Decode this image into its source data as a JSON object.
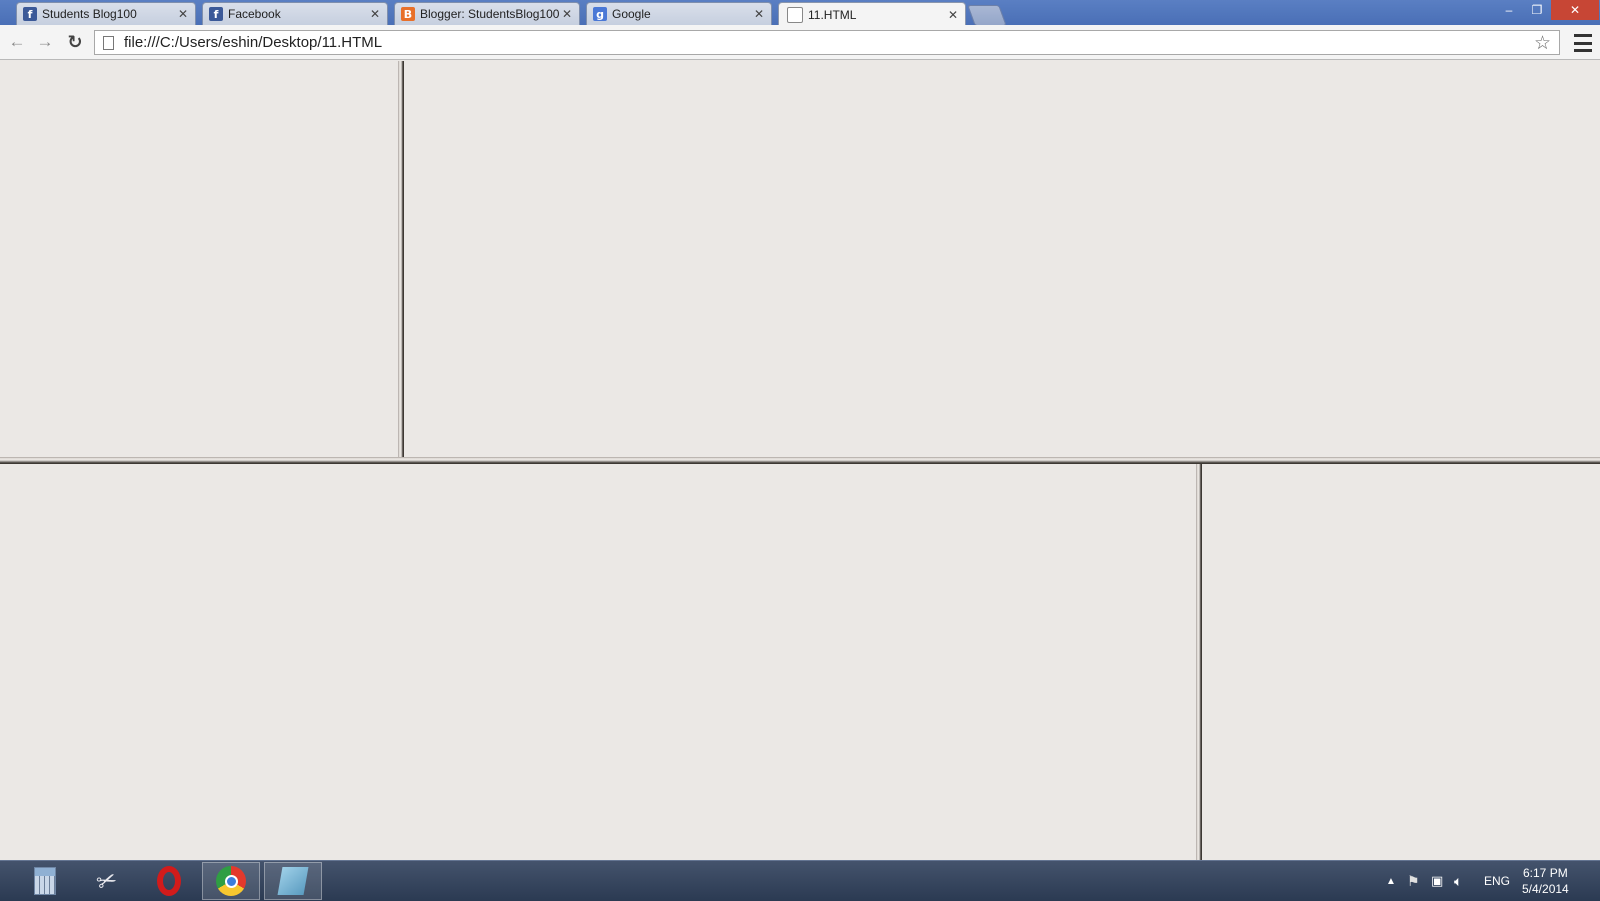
{
  "browser": {
    "tabs": [
      {
        "label": "Students Blog100",
        "icon": "facebook-icon",
        "active": false
      },
      {
        "label": "Facebook",
        "icon": "facebook-icon",
        "active": false
      },
      {
        "label": "Blogger: StudentsBlog100",
        "icon": "blogger-icon",
        "active": false
      },
      {
        "label": "Google",
        "icon": "google-icon",
        "active": false
      },
      {
        "label": "11.HTML",
        "icon": "document-icon",
        "active": true
      }
    ],
    "address": "file:///C:/Users/eshin/Desktop/11.HTML",
    "colors": {
      "titlebar": "#4a6fb6",
      "close_button": "#c74635",
      "page_background": "#ebe8e5"
    }
  },
  "window_controls": {
    "minimize": "–",
    "maximize": "❐",
    "close": "✕"
  },
  "taskbar": {
    "apps": [
      "calculator-icon",
      "snipping-tool-icon",
      "opera-icon",
      "chrome-icon",
      "sticky-notes-icon"
    ],
    "tray": {
      "language": "ENG",
      "time": "6:17 PM",
      "date": "5/4/2014"
    }
  }
}
